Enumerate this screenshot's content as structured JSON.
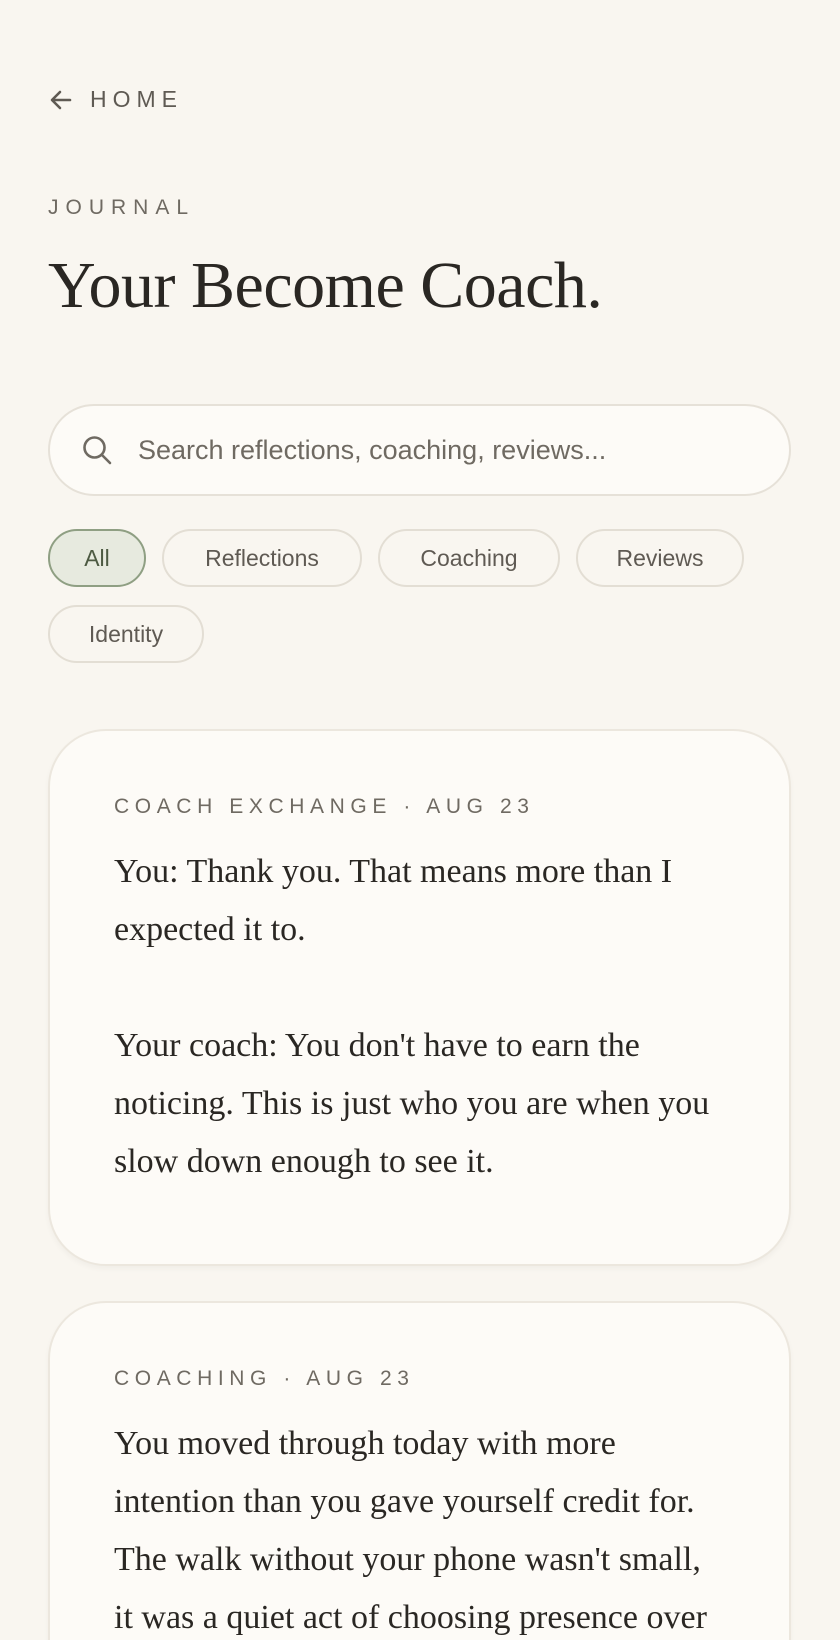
{
  "nav": {
    "back_label": "HOME",
    "back_icon": "arrow-left-icon"
  },
  "header": {
    "eyebrow": "JOURNAL",
    "title": "Your Become Coach."
  },
  "search": {
    "placeholder": "Search reflections, coaching, reviews...",
    "value": "",
    "icon": "search-icon"
  },
  "filters": {
    "selected": "All",
    "chips": [
      {
        "label": "All",
        "active": true
      },
      {
        "label": "Reflections",
        "active": false
      },
      {
        "label": "Coaching",
        "active": false
      },
      {
        "label": "Reviews",
        "active": false
      },
      {
        "label": "Identity",
        "active": false
      }
    ]
  },
  "entries": [
    {
      "type": "COACH EXCHANGE",
      "date": "AUG 23",
      "meta": "COACH EXCHANGE · AUG 23",
      "text": "You: Thank you. That means more than I expected it to.\n\nYour coach: You don't have to earn the noticing. This is just who you are when you slow down enough to see it."
    },
    {
      "type": "COACHING",
      "date": "AUG 23",
      "meta": "COACHING · AUG 23",
      "text": "You moved through today with more intention than you gave yourself credit for. The walk without your phone wasn't small, it was a quiet act of choosing presence over"
    }
  ],
  "colors": {
    "background": "#f9f6f0",
    "card": "#fdfbf7",
    "text": "#2a2723",
    "muted": "#6f6a62",
    "active_chip_bg": "#e7eadf",
    "active_chip_border": "#8f9f83"
  }
}
